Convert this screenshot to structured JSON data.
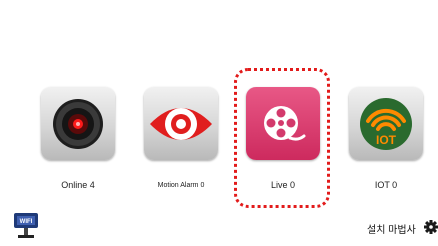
{
  "tiles": [
    {
      "id": "online",
      "label": "Online 4",
      "icon": "online-camera-icon"
    },
    {
      "id": "motion-alarm",
      "label": "Motion Alarm 0",
      "icon": "motion-alarm-eye-icon"
    },
    {
      "id": "live",
      "label": "Live 0",
      "icon": "live-film-reel-icon"
    },
    {
      "id": "iot",
      "label": "IOT 0",
      "icon": "iot-wifi-icon"
    }
  ],
  "footer": {
    "wizard_label": "설치 마법사",
    "device_icon_text": "WIFI"
  },
  "colors": {
    "online_accent": "#ff1a1a",
    "motion_red": "#e01e1e",
    "live_pink": "#d33a6c",
    "iot_green": "#2a6a2e",
    "iot_orange": "#ff8a00",
    "highlight_dash": "#e21b1b"
  }
}
